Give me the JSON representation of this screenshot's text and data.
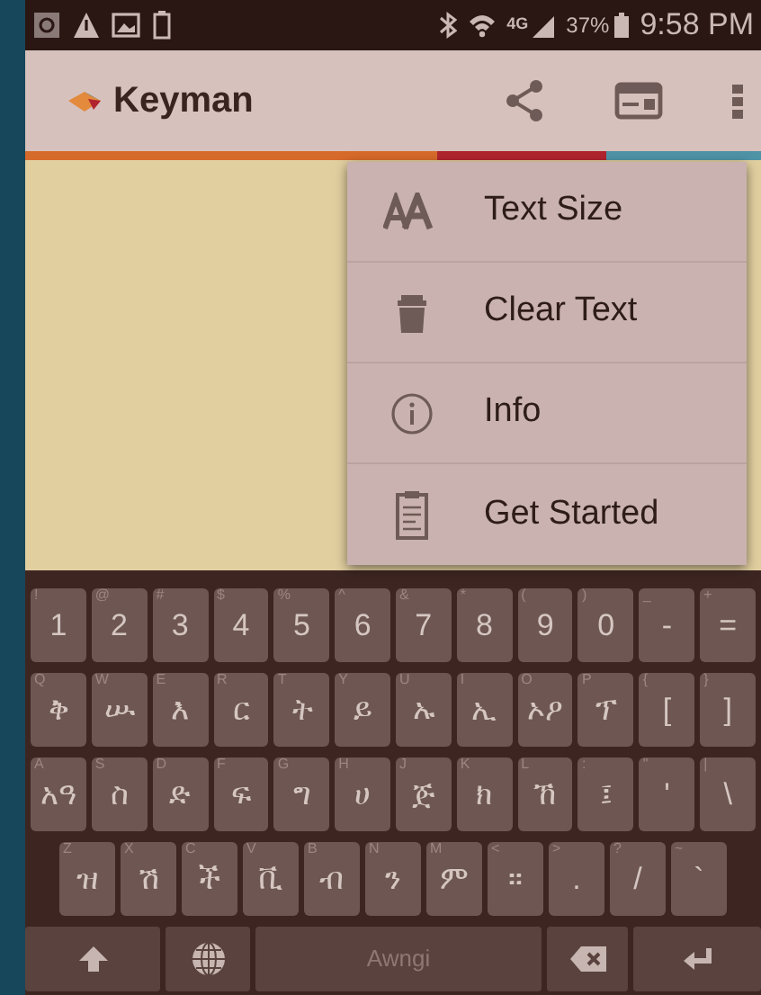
{
  "status_bar": {
    "network": "4G",
    "battery": "37%",
    "time": "9:58 PM"
  },
  "app_bar": {
    "title": "Keyman"
  },
  "menu": [
    {
      "label": "Text Size",
      "kind": "text-size"
    },
    {
      "label": "Clear Text",
      "kind": "clear"
    },
    {
      "label": "Info",
      "kind": "info"
    },
    {
      "label": "Get Started",
      "kind": "get-started"
    }
  ],
  "keyboard": {
    "rows": [
      [
        {
          "label": "1",
          "hint": "!"
        },
        {
          "label": "2",
          "hint": "@"
        },
        {
          "label": "3",
          "hint": "#"
        },
        {
          "label": "4",
          "hint": "$"
        },
        {
          "label": "5",
          "hint": "%"
        },
        {
          "label": "6",
          "hint": "^"
        },
        {
          "label": "7",
          "hint": "&"
        },
        {
          "label": "8",
          "hint": "*"
        },
        {
          "label": "9",
          "hint": "("
        },
        {
          "label": "0",
          "hint": ")"
        },
        {
          "label": "-",
          "hint": "_"
        },
        {
          "label": "=",
          "hint": "+"
        }
      ],
      [
        {
          "label": "ቅ",
          "hint": "Q"
        },
        {
          "label": "ሡ",
          "hint": "W"
        },
        {
          "label": "እ",
          "hint": "E"
        },
        {
          "label": "ር",
          "hint": "R"
        },
        {
          "label": "ት",
          "hint": "T"
        },
        {
          "label": "ይ",
          "hint": "Y"
        },
        {
          "label": "ኡ",
          "hint": "U"
        },
        {
          "label": "ኢ",
          "hint": "I"
        },
        {
          "label": "ኦዖ",
          "hint": "O"
        },
        {
          "label": "ፕ",
          "hint": "P"
        },
        {
          "label": "[",
          "hint": "{"
        },
        {
          "label": "]",
          "hint": "}"
        }
      ],
      [
        {
          "label": "አዓ",
          "hint": "A"
        },
        {
          "label": "ስ",
          "hint": "S"
        },
        {
          "label": "ድ",
          "hint": "D"
        },
        {
          "label": "ፍ",
          "hint": "F"
        },
        {
          "label": "ግ",
          "hint": "G"
        },
        {
          "label": "ሀ",
          "hint": "H"
        },
        {
          "label": "ጅ",
          "hint": "J"
        },
        {
          "label": "ክ",
          "hint": "K"
        },
        {
          "label": "ኸ",
          "hint": "L"
        },
        {
          "label": "፤",
          "hint": ":"
        },
        {
          "label": "'",
          "hint": "\""
        },
        {
          "label": "\\",
          "hint": "|"
        }
      ],
      [
        {
          "label": "ዝ",
          "hint": "Z"
        },
        {
          "label": "ሽ",
          "hint": "X"
        },
        {
          "label": "ች",
          "hint": "C"
        },
        {
          "label": "ቪ",
          "hint": "V"
        },
        {
          "label": "ብ",
          "hint": "B"
        },
        {
          "label": "ን",
          "hint": "N"
        },
        {
          "label": "ም",
          "hint": "M"
        },
        {
          "label": "።",
          "hint": "<"
        },
        {
          "label": ".",
          "hint": ">"
        },
        {
          "label": "/",
          "hint": "?"
        },
        {
          "label": "`",
          "hint": "~"
        }
      ]
    ],
    "bottom": [
      {
        "kind": "shift"
      },
      {
        "kind": "globe"
      },
      {
        "kind": "space",
        "label": "Awngi"
      },
      {
        "kind": "backspace"
      },
      {
        "kind": "enter"
      }
    ]
  }
}
